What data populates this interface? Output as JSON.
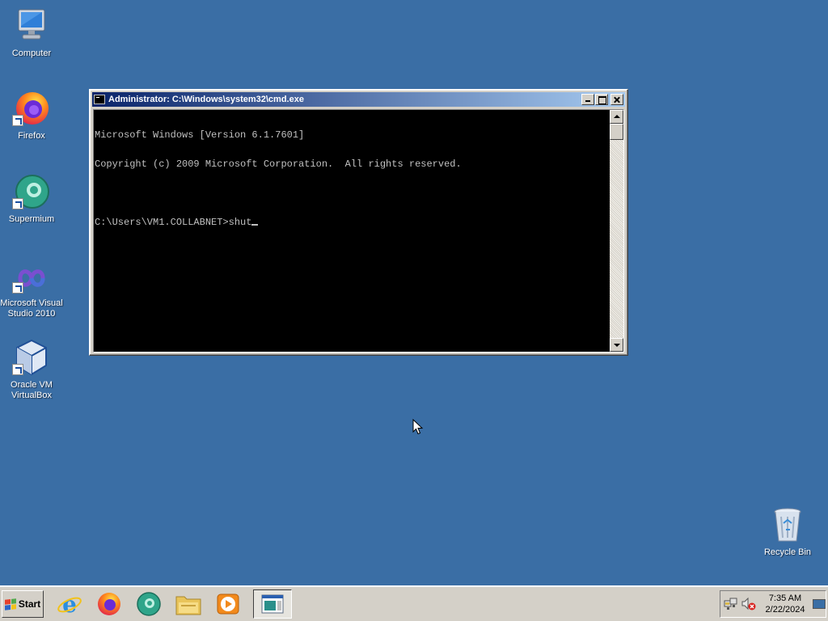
{
  "desktop": {
    "background_color": "#3a6ea5",
    "icons": [
      {
        "label": "Computer",
        "icon": "computer-icon"
      },
      {
        "label": "Firefox",
        "icon": "firefox-icon"
      },
      {
        "label": "Supermium",
        "icon": "supermium-icon"
      },
      {
        "label": "Microsoft Visual Studio 2010",
        "icon": "visual-studio-icon"
      },
      {
        "label": "Oracle VM VirtualBox",
        "icon": "virtualbox-icon"
      },
      {
        "label": "Recycle Bin",
        "icon": "recycle-bin-icon"
      }
    ]
  },
  "cmd_window": {
    "title": "Administrator: C:\\Windows\\system32\\cmd.exe",
    "lines": [
      "Microsoft Windows [Version 6.1.7601]",
      "Copyright (c) 2009 Microsoft Corporation.  All rights reserved.",
      "",
      "C:\\Users\\VM1.COLLABNET>shut"
    ],
    "colors": {
      "background": "#000000",
      "text": "#c0c0c0",
      "titlebar_start": "#0a246a",
      "titlebar_end": "#a6caf0"
    }
  },
  "taskbar": {
    "start_label": "Start",
    "quick_launch": [
      {
        "icon": "internet-explorer-icon"
      },
      {
        "icon": "firefox-icon"
      },
      {
        "icon": "supermium-icon"
      },
      {
        "icon": "windows-explorer-icon"
      },
      {
        "icon": "media-player-icon"
      }
    ],
    "active_task_icon": "cmd-window-icon",
    "tray": {
      "icons": [
        "network-icon",
        "volume-muted-icon"
      ],
      "time": "7:35 AM",
      "date": "2/22/2024"
    }
  }
}
